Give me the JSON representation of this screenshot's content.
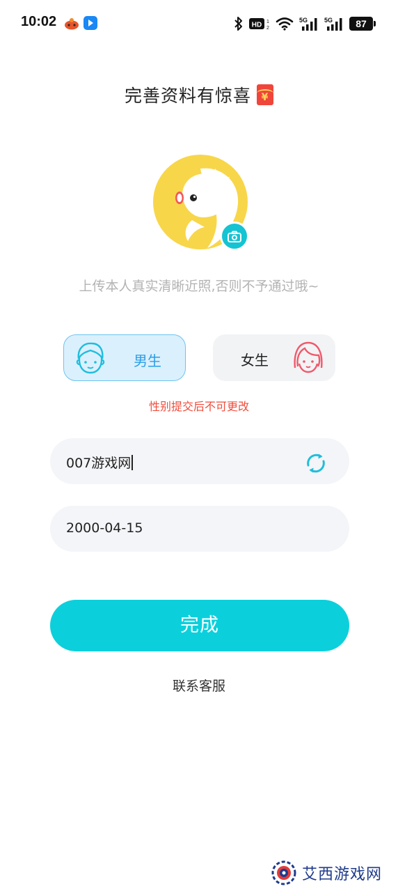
{
  "status_bar": {
    "time": "10:02",
    "battery": "87",
    "icons": [
      "bluetooth-icon",
      "hd-icon",
      "wifi-icon",
      "5g-signal-icon",
      "5g-signal-icon"
    ]
  },
  "header": {
    "title": "完善资料有惊喜",
    "envelope_symbol": "¥"
  },
  "avatar": {
    "hint": "上传本人真实清晰近照,否则不予通过哦~"
  },
  "gender": {
    "male_label": "男生",
    "female_label": "女生",
    "selected": "male",
    "warning": "性别提交后不可更改"
  },
  "form": {
    "nickname_value": "007游戏网",
    "birthday_value": "2000-04-15",
    "submit_label": "完成",
    "support_label": "联系客服"
  },
  "watermark": {
    "text": "艾西游戏网"
  },
  "colors": {
    "accent": "#0bd0dc",
    "male_text": "#2a9ee6",
    "male_bg": "#dbf0fd",
    "female_icon": "#f0596b",
    "warning": "#f04b3a",
    "avatar_yellow": "#f8d64a"
  }
}
